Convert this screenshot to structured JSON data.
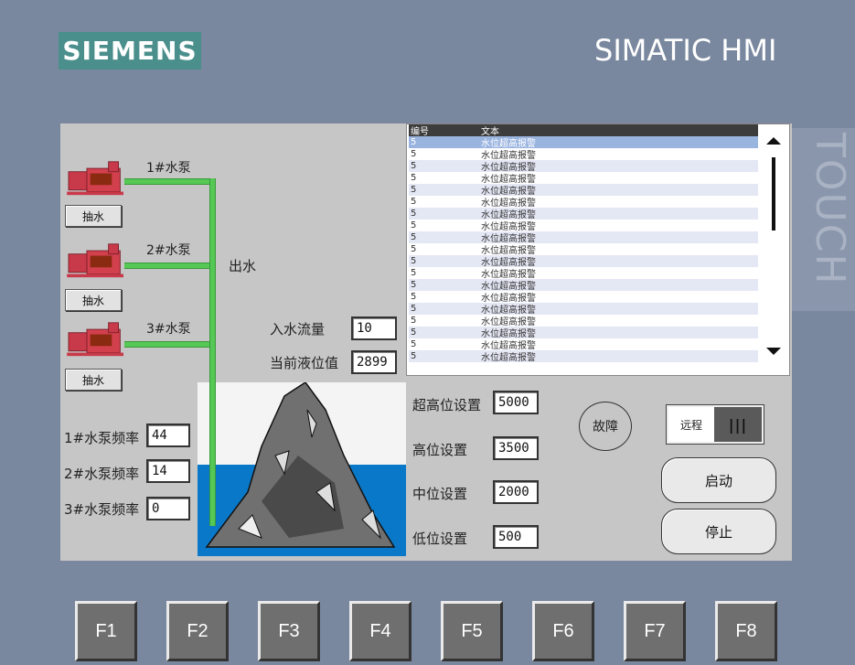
{
  "brand": {
    "logo": "SIEMENS",
    "product": "SIMATIC HMI",
    "side": "TOUCH"
  },
  "pumps": [
    {
      "name": "1#水泵",
      "button": "抽水"
    },
    {
      "name": "2#水泵",
      "button": "抽水"
    },
    {
      "name": "3#水泵",
      "button": "抽水"
    }
  ],
  "outlet_label": "出水",
  "inflow": {
    "label": "入水流量",
    "value": "10"
  },
  "level": {
    "label": "当前液位值",
    "value": "2899"
  },
  "frequencies": [
    {
      "label": "1#水泵频率",
      "value": "44"
    },
    {
      "label": "2#水泵频率",
      "value": "14"
    },
    {
      "label": "3#水泵频率",
      "value": "0"
    }
  ],
  "settings": [
    {
      "label": "超高位设置",
      "value": "5000"
    },
    {
      "label": "高位设置",
      "value": "3500"
    },
    {
      "label": "中位设置",
      "value": "2000"
    },
    {
      "label": "低位设置",
      "value": "500"
    }
  ],
  "alarm": {
    "headers": [
      "编号",
      "文本"
    ],
    "rows": [
      [
        "5",
        "水位超高报警"
      ],
      [
        "5",
        "水位超高报警"
      ],
      [
        "5",
        "水位超高报警"
      ],
      [
        "5",
        "水位超高报警"
      ],
      [
        "5",
        "水位超高报警"
      ],
      [
        "5",
        "水位超高报警"
      ],
      [
        "5",
        "水位超高报警"
      ],
      [
        "5",
        "水位超高报警"
      ],
      [
        "5",
        "水位超高报警"
      ],
      [
        "5",
        "水位超高报警"
      ],
      [
        "5",
        "水位超高报警"
      ],
      [
        "5",
        "水位超高报警"
      ],
      [
        "5",
        "水位超高报警"
      ],
      [
        "5",
        "水位超高报警"
      ],
      [
        "5",
        "水位超高报警"
      ],
      [
        "5",
        "水位超高报警"
      ],
      [
        "5",
        "水位超高报警"
      ],
      [
        "5",
        "水位超高报警"
      ],
      [
        "5",
        "水位超高报警"
      ]
    ]
  },
  "controls": {
    "fault": "故障",
    "remote": "远程",
    "remote_toggle": "|||",
    "start": "启动",
    "stop": "停止"
  },
  "fkeys": [
    "F1",
    "F2",
    "F3",
    "F4",
    "F5",
    "F6",
    "F7",
    "F8"
  ],
  "colors": {
    "water": "#0a78c8",
    "pipe": "#55c855",
    "pump": "#c83a4a",
    "logo_bg": "#4b8f8c"
  }
}
